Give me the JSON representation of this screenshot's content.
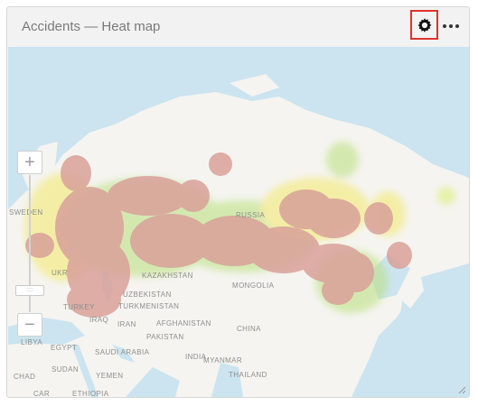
{
  "widget": {
    "title": "Accidents — Heat map",
    "settings_icon": "gear-icon",
    "more_icon": "more-dots-icon",
    "highlight_color": "#e0332d"
  },
  "map": {
    "zoom_in_label": "+",
    "zoom_out_label": "−",
    "heat_color": "#d9a19a",
    "labels": {
      "sweden": "SWEDEN",
      "russia": "RUSSIA",
      "ukraine": "UKR",
      "kazakhstan": "KAZAKHSTAN",
      "uzbekistan": "UZBEKISTAN",
      "turkmenistan": "TURKMENISTAN",
      "turkey": "TURKEY",
      "mongolia": "MONGOLIA",
      "afghanistan": "AFGHANISTAN",
      "iraq": "IRAQ",
      "iran": "IRAN",
      "pakistan": "PAKISTAN",
      "china": "CHINA",
      "libya": "LIBYA",
      "egypt": "EGYPT",
      "saudi_arabia": "SAUDI ARABIA",
      "india": "INDIA",
      "myanmar": "MYANMAR",
      "thailand": "THAILAND",
      "chad": "CHAD",
      "sudan": "SUDAN",
      "yemen": "YEMEN",
      "car": "CAR",
      "ethiopia": "ETHIOPIA"
    }
  }
}
